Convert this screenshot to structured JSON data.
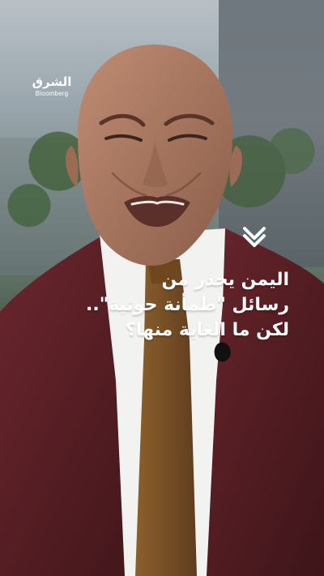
{
  "logo": {
    "primary": "الشرق",
    "secondary": "Bloomberg"
  },
  "headline": {
    "lines": [
      "اليمن يحذر من",
      "رسائل \"طمأنة حوثية\"..",
      "لكن ما الغاية منها؟"
    ]
  },
  "icons": {
    "chevron": "chevron-down-icon"
  },
  "colors": {
    "text": "#ffffff",
    "jacket": "#5b1f23",
    "tie": "#7b5226",
    "shirt": "#f2f3f0"
  }
}
